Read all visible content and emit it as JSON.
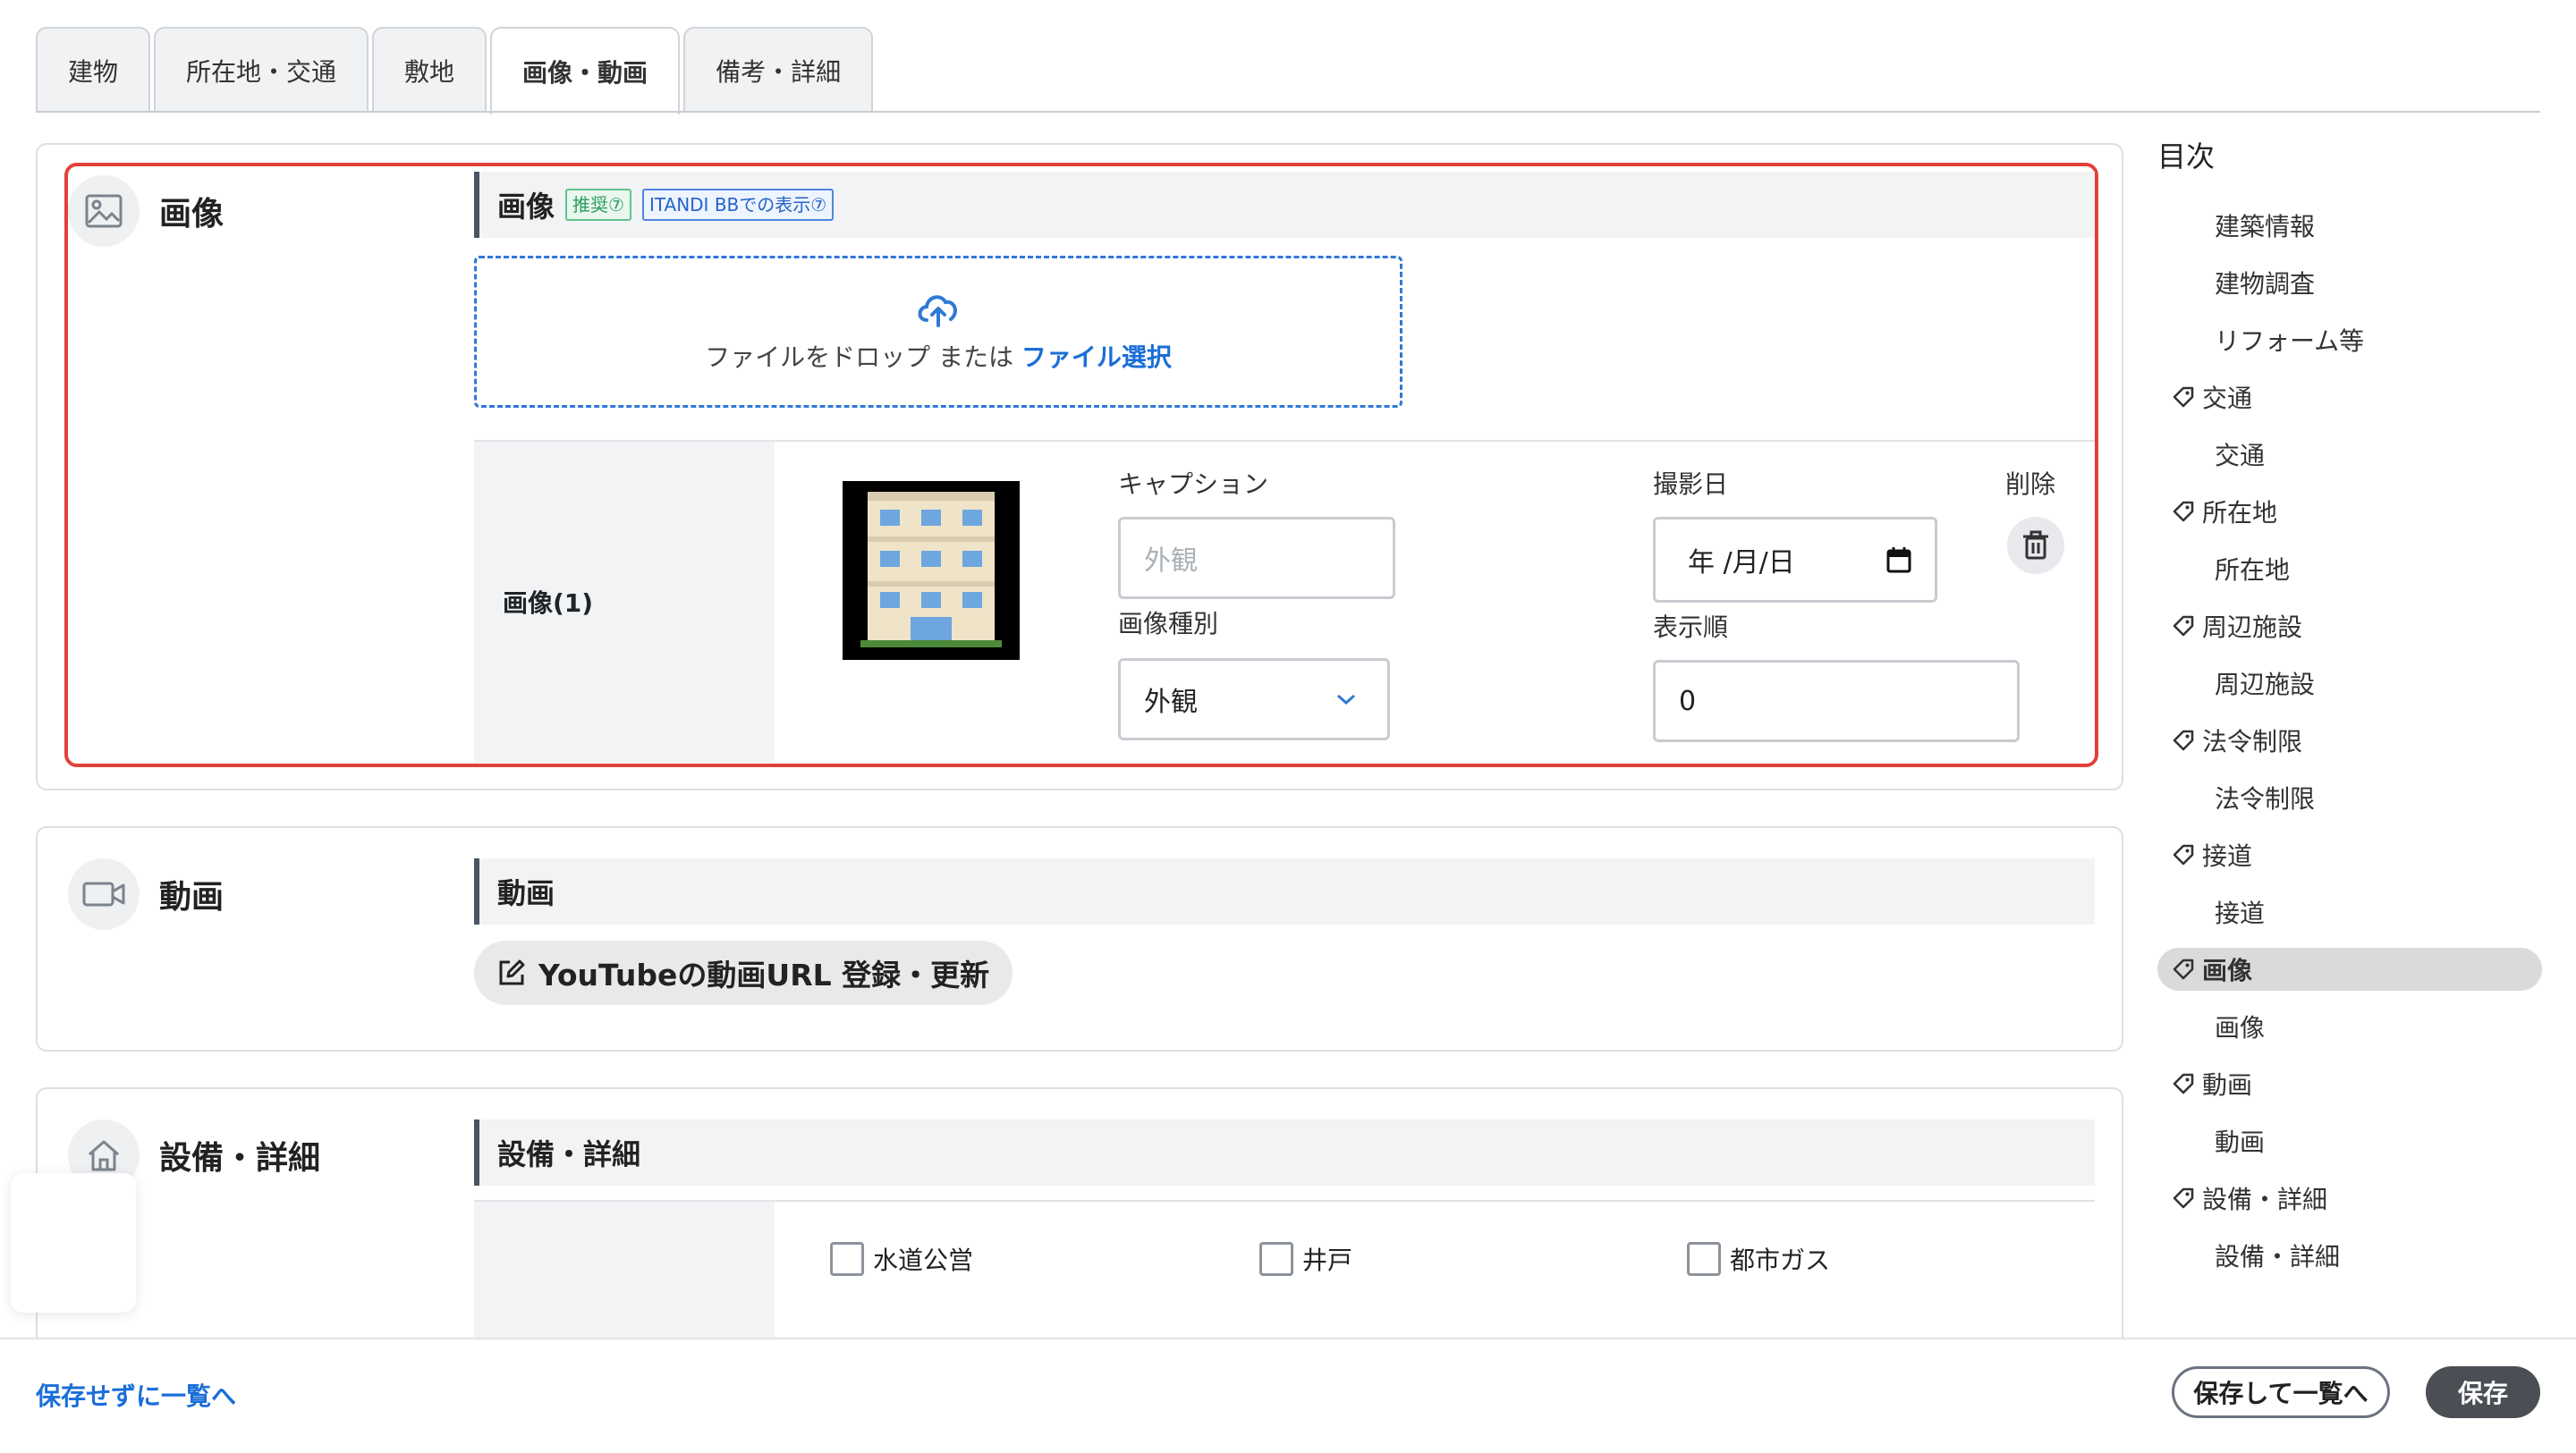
{
  "tabs": [
    {
      "label": "建物"
    },
    {
      "label": "所在地・交通"
    },
    {
      "label": "敷地"
    },
    {
      "label": "画像・動画"
    },
    {
      "label": "備考・詳細"
    }
  ],
  "image_section": {
    "title": "画像",
    "subhead": "画像",
    "badge_recommended": "推奨⑦",
    "badge_itandi": "ITANDI BBでの表示⑦",
    "drop_text": "ファイルをドロップ または",
    "drop_link": "ファイル選択",
    "row_label": "画像(1)",
    "caption_label": "キャプション",
    "caption_placeholder": "外観",
    "type_label": "画像種別",
    "type_value": "外観",
    "date_label": "撮影日",
    "date_value": "年 /月/日",
    "delete_label": "削除",
    "order_label": "表示順",
    "order_value": "0"
  },
  "video_section": {
    "title": "動画",
    "subhead": "動画",
    "button_label": "YouTubeの動画URL 登録・更新"
  },
  "equipment_section": {
    "title": "設備・詳細",
    "subhead": "設備・詳細",
    "checks": [
      {
        "label": "水道公営"
      },
      {
        "label": "井戸"
      },
      {
        "label": "都市ガス"
      }
    ]
  },
  "toc": {
    "title": "目次",
    "items": [
      {
        "label": "建築情報",
        "kind": "sub"
      },
      {
        "label": "建物調査",
        "kind": "sub"
      },
      {
        "label": "リフォーム等",
        "kind": "sub"
      },
      {
        "label": "交通",
        "kind": "sec"
      },
      {
        "label": "交通",
        "kind": "sub"
      },
      {
        "label": "所在地",
        "kind": "sec"
      },
      {
        "label": "所在地",
        "kind": "sub"
      },
      {
        "label": "周辺施設",
        "kind": "sec"
      },
      {
        "label": "周辺施設",
        "kind": "sub"
      },
      {
        "label": "法令制限",
        "kind": "sec"
      },
      {
        "label": "法令制限",
        "kind": "sub"
      },
      {
        "label": "接道",
        "kind": "sec"
      },
      {
        "label": "接道",
        "kind": "sub"
      },
      {
        "label": "画像",
        "kind": "sec-active"
      },
      {
        "label": "画像",
        "kind": "sub"
      },
      {
        "label": "動画",
        "kind": "sec"
      },
      {
        "label": "動画",
        "kind": "sub"
      },
      {
        "label": "設備・詳細",
        "kind": "sec"
      },
      {
        "label": "設備・詳細",
        "kind": "sub"
      }
    ]
  },
  "footer": {
    "back_link": "保存せずに一覧へ",
    "save_back": "保存して一覧へ",
    "save": "保存"
  },
  "colors": {
    "accent_blue": "#1a6ed8",
    "highlight_red": "#e2413a",
    "dark_button": "#4b4f55"
  }
}
